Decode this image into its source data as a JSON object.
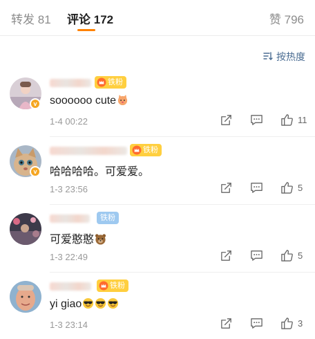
{
  "tabs": [
    {
      "label": "转发",
      "count": "81"
    },
    {
      "label": "评论",
      "count": "172"
    },
    {
      "label": "赞",
      "count": "796"
    }
  ],
  "sort_label": "按热度",
  "fan_badge_label": "铁粉",
  "comments": [
    {
      "text": "soooooo cute",
      "emoji": "kitten-face",
      "time": "1-4 00:22",
      "likes": "11"
    },
    {
      "text": "哈哈哈哈。可爱爱。",
      "emoji": "",
      "time": "1-3 23:56",
      "likes": "5"
    },
    {
      "text": "可爱憨憨",
      "emoji": "bear-face",
      "time": "1-3 22:49",
      "likes": "5"
    },
    {
      "text": "yi giao",
      "emoji": "sunglasses-face x3",
      "time": "1-3 23:14",
      "likes": "3"
    }
  ],
  "colors": {
    "accent": "#ff8200",
    "link": "#4a6c92",
    "fan_badge": "#ffcf3f",
    "fan_badge_blue": "#9ec9f0"
  }
}
